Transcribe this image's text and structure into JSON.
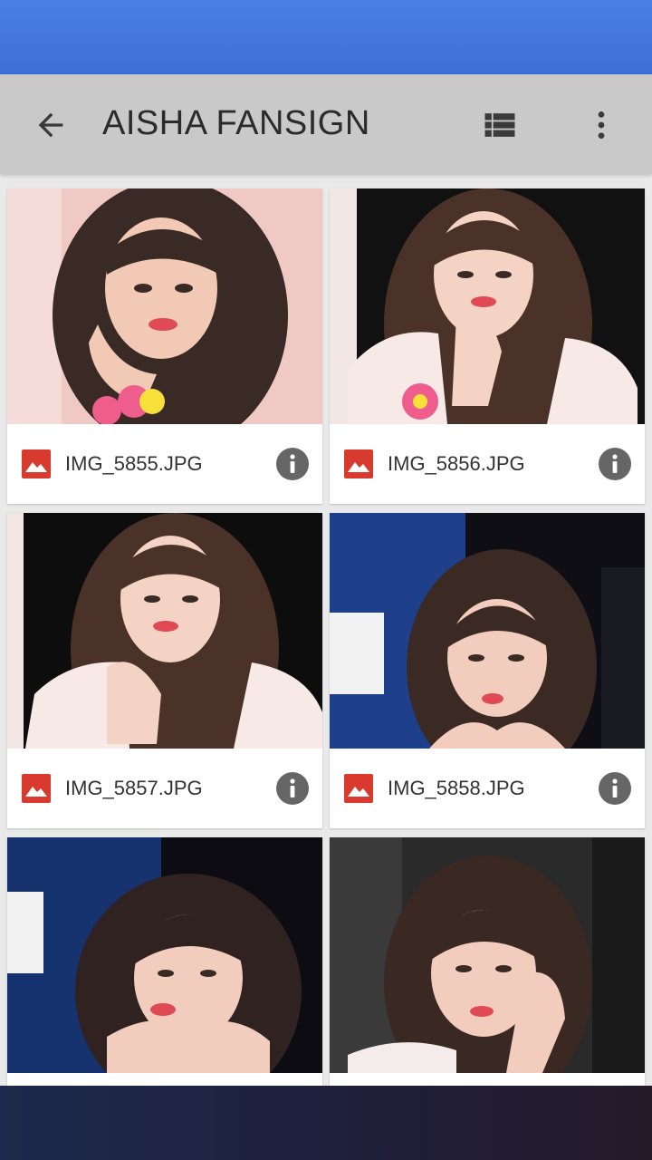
{
  "app_bar": {
    "title": "AISHA FANSIGN",
    "color": "#c9c9c9"
  },
  "icons": {
    "back": "arrow-back-icon",
    "list_view": "view-list-icon",
    "more": "more-vert-icon",
    "file": "image-file-icon",
    "info": "info-icon"
  },
  "colors": {
    "status_bar": "#3b6fd6",
    "file_icon": "#d93a2e",
    "info_icon": "#666666",
    "background": "#e9e9e9"
  },
  "files": [
    {
      "name": "IMG_5855.JPG",
      "bg": "#f0c9c4",
      "hair": "#3a2a26"
    },
    {
      "name": "IMG_5856.JPG",
      "bg": "#111111",
      "hair": "#4a3228"
    },
    {
      "name": "IMG_5857.JPG",
      "bg": "#0d0d0d",
      "hair": "#4a3228"
    },
    {
      "name": "IMG_5858.JPG",
      "bg": "#1e3f8a",
      "hair": "#3b2a24"
    },
    {
      "name": "",
      "bg": "#16336f",
      "hair": "#2f2220"
    },
    {
      "name": "",
      "bg": "#2a2a2a",
      "hair": "#3a2823"
    }
  ]
}
